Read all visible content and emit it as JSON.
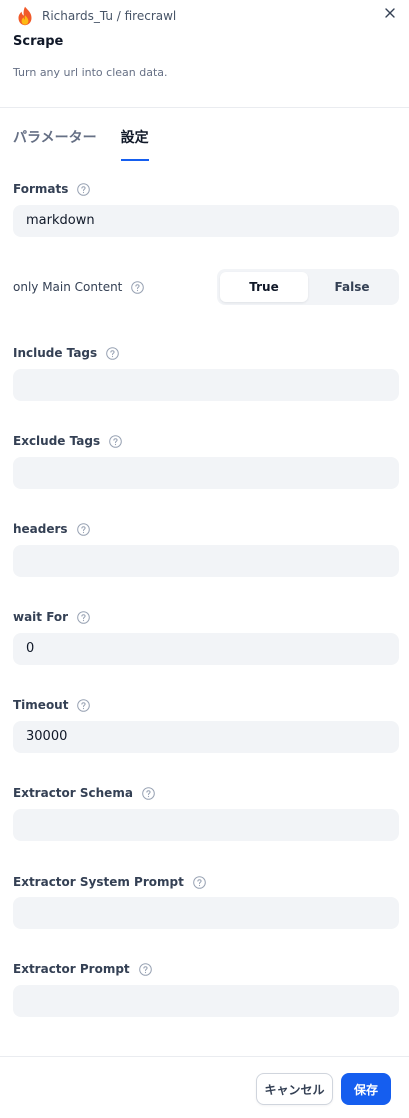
{
  "header": {
    "brand": "Richards_Tu / firecrawl",
    "title": "Scrape",
    "subtitle": "Turn any url into clean data."
  },
  "tabs": [
    {
      "label": "パラメーター",
      "active": false
    },
    {
      "label": "設定",
      "active": true
    }
  ],
  "fields": {
    "formats": {
      "label": "Formats",
      "value": "markdown"
    },
    "only_main_content": {
      "label": "only Main Content",
      "options": [
        "True",
        "False"
      ],
      "selected": "True"
    },
    "include_tags": {
      "label": "Include Tags",
      "value": ""
    },
    "exclude_tags": {
      "label": "Exclude Tags",
      "value": ""
    },
    "headers": {
      "label": "headers",
      "value": ""
    },
    "wait_for": {
      "label": "wait For",
      "value": "0"
    },
    "timeout": {
      "label": "Timeout",
      "value": "30000"
    },
    "extractor_schema": {
      "label": "Extractor Schema",
      "value": ""
    },
    "extractor_system_prompt": {
      "label": "Extractor System Prompt",
      "value": ""
    },
    "extractor_prompt": {
      "label": "Extractor Prompt",
      "value": ""
    }
  },
  "footer": {
    "cancel_label": "キャンセル",
    "save_label": "保存"
  },
  "colors": {
    "accent": "#155eef",
    "field_bg": "#f2f4f7"
  }
}
